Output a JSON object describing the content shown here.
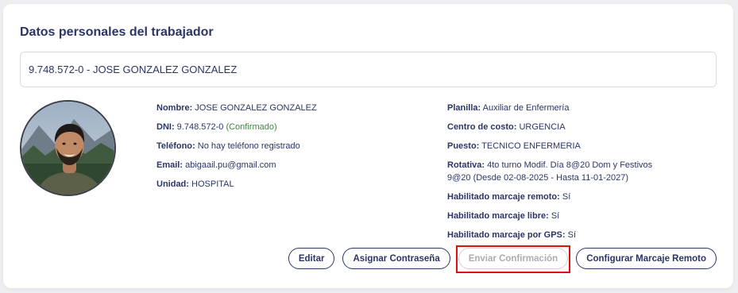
{
  "card": {
    "title": "Datos personales del trabajador"
  },
  "worker_select": {
    "value": "9.748.572-0 - JOSE GONZALEZ GONZALEZ"
  },
  "left_fields": [
    {
      "label": "Nombre:",
      "value": "JOSE GONZALEZ GONZALEZ"
    },
    {
      "label": "DNI:",
      "value": "9.748.572-0",
      "status": "(Confirmado)"
    },
    {
      "label": "Teléfono:",
      "value": "No hay teléfono registrado"
    },
    {
      "label": "Email:",
      "value": "abigaail.pu@gmail.com"
    },
    {
      "label": "Unidad:",
      "value": "HOSPITAL"
    }
  ],
  "right_fields": [
    {
      "label": "Planilla:",
      "value": "Auxiliar de Enfermería"
    },
    {
      "label": "Centro de costo:",
      "value": "URGENCIA"
    },
    {
      "label": "Puesto:",
      "value": "TECNICO ENFERMERIA"
    },
    {
      "label": "Rotativa:",
      "value": "4to turno Modif. Día 8@20 Dom y Festivos 9@20 (Desde 02-08-2025 - Hasta 11-01-2027)"
    },
    {
      "label": "Habilitado marcaje remoto:",
      "value": "Sí"
    },
    {
      "label": "Habilitado marcaje libre:",
      "value": "Sí"
    },
    {
      "label": "Habilitado marcaje por GPS:",
      "value": "Sí"
    }
  ],
  "actions": {
    "edit": "Editar",
    "assign_password": "Asignar Contraseña",
    "send_confirmation": "Enviar Confirmación",
    "configure_remote": "Configurar Marcaje Remoto"
  },
  "colors": {
    "primary": "#2b3566",
    "confirmed": "#3a8a3a",
    "highlight": "#e01010"
  }
}
